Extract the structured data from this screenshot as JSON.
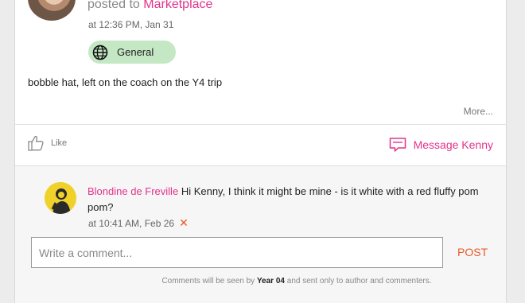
{
  "post": {
    "posted_prefix": "posted to",
    "channel": "Marketplace",
    "time": "at 12:36 PM, Jan 31",
    "tag": {
      "label": "General",
      "icon": "globe-icon",
      "color": "#c4e7c4"
    },
    "body": "bobble hat, left on the coach on the Y4 trip",
    "more_label": "More..."
  },
  "actions": {
    "like_label": "Like",
    "like_icon": "thumbs-up-icon",
    "message_label": "Message Kenny",
    "message_icon": "message-icon"
  },
  "comments": [
    {
      "author": "Blondine de Freville",
      "text": "Hi Kenny, I think it might be mine - is it white with a red fluffy pom pom?",
      "time": "at 10:41 AM, Feb 26",
      "delete_glyph": "✕"
    }
  ],
  "composer": {
    "placeholder": "Write a comment...",
    "post_label": "POST",
    "note_prefix": "Comments will be seen by",
    "note_group": "Year 04",
    "note_suffix": "and sent only to author and commenters."
  },
  "colors": {
    "accent": "#e2338a",
    "post": "#e85a2a",
    "tag_bg": "#c4e7c4"
  }
}
